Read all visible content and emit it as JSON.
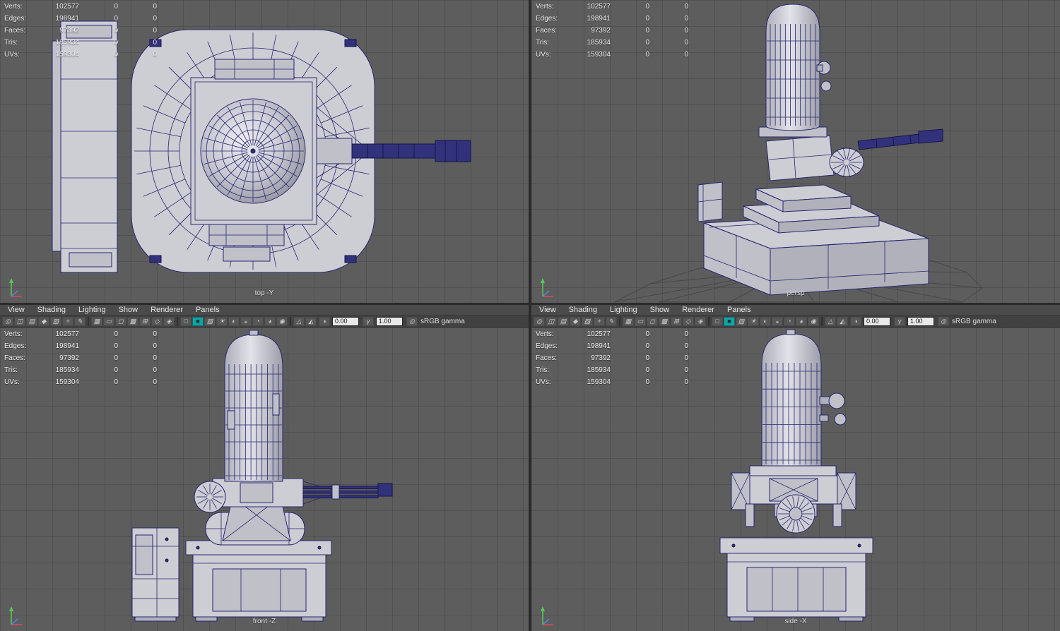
{
  "hud": {
    "rows": [
      {
        "name": "hud-row-verts",
        "label": "Verts:",
        "value": "102577",
        "c2": "0",
        "c3": "0"
      },
      {
        "name": "hud-row-edges",
        "label": "Edges:",
        "value": "198941",
        "c2": "0",
        "c3": "0"
      },
      {
        "name": "hud-row-faces",
        "label": "Faces:",
        "value": "97392",
        "c2": "0",
        "c3": "0"
      },
      {
        "name": "hud-row-tris",
        "label": "Tris:",
        "value": "185934",
        "c2": "0",
        "c3": "0"
      },
      {
        "name": "hud-row-uvs",
        "label": "UVs:",
        "value": "159304",
        "c2": "0",
        "c3": "0"
      }
    ]
  },
  "menus": [
    {
      "name": "menu-view",
      "label": "View"
    },
    {
      "name": "menu-shading",
      "label": "Shading"
    },
    {
      "name": "menu-lighting",
      "label": "Lighting"
    },
    {
      "name": "menu-show",
      "label": "Show"
    },
    {
      "name": "menu-renderer",
      "label": "Renderer"
    },
    {
      "name": "menu-panels",
      "label": "Panels"
    }
  ],
  "toolbar": {
    "icons": [
      {
        "name": "select-camera-icon",
        "glyph": "◎"
      },
      {
        "name": "lock-camera-icon",
        "glyph": "◫"
      },
      {
        "name": "camera-attributes-icon",
        "glyph": "▤"
      },
      {
        "name": "bookmarks-icon",
        "glyph": "◆"
      },
      {
        "name": "image-plane-icon",
        "glyph": "▧"
      },
      {
        "name": "two-d-pan-zoom-icon",
        "glyph": "+"
      },
      {
        "name": "grease-pencil-icon",
        "glyph": "✎"
      },
      {
        "name": "toolbar-separator",
        "kind": "sep",
        "glyph": "",
        "interactable": false
      },
      {
        "name": "grid-toggle-icon",
        "glyph": "▦"
      },
      {
        "name": "film-gate-icon",
        "glyph": "▭"
      },
      {
        "name": "resolution-gate-icon",
        "glyph": "◻"
      },
      {
        "name": "gate-mask-icon",
        "glyph": "▩"
      },
      {
        "name": "field-chart-icon",
        "glyph": "⊞"
      },
      {
        "name": "safe-action-icon",
        "glyph": "◇"
      },
      {
        "name": "safe-title-icon",
        "glyph": "◈"
      },
      {
        "name": "toolbar-separator",
        "kind": "sep",
        "glyph": "",
        "interactable": false
      },
      {
        "name": "wireframe-icon",
        "glyph": "□"
      },
      {
        "name": "shaded-icon",
        "glyph": "■",
        "kind": "accent"
      },
      {
        "name": "textured-icon",
        "glyph": "▨"
      },
      {
        "name": "lights-icon",
        "glyph": "☀"
      },
      {
        "name": "shadows-icon",
        "glyph": "◐"
      },
      {
        "name": "ambient-occlusion-icon",
        "glyph": "◒"
      },
      {
        "name": "motion-blur-icon",
        "glyph": "◔"
      },
      {
        "name": "anti-aliasing-icon",
        "glyph": "◕"
      },
      {
        "name": "depth-of-field-icon",
        "glyph": "◉"
      },
      {
        "name": "toolbar-separator",
        "kind": "sep",
        "glyph": "",
        "interactable": false
      },
      {
        "name": "isolate-select-icon",
        "glyph": "△"
      },
      {
        "name": "xray-icon",
        "glyph": "◭"
      }
    ],
    "exposure_icon": {
      "glyph": "◑"
    },
    "exposure_value": "0.00",
    "gamma_icon": {
      "glyph": "γ"
    },
    "gamma_value": "1.00",
    "view_transform_icon": {
      "glyph": "◎"
    },
    "view_transform": "sRGB gamma"
  },
  "viewports": [
    {
      "label": "top -Y"
    },
    {
      "label": "persp"
    },
    {
      "label": "front -Z"
    },
    {
      "label": "side -X"
    }
  ],
  "colors": {
    "viewport_bg": "#5d5d5d",
    "wireframe": "#26266e",
    "model_fill": "#cdcdd4",
    "accent_teal": "#14a2a2",
    "axis_y": "#57c957",
    "axis_x": "#d04f4f",
    "axis_z": "#5f7fd9"
  }
}
